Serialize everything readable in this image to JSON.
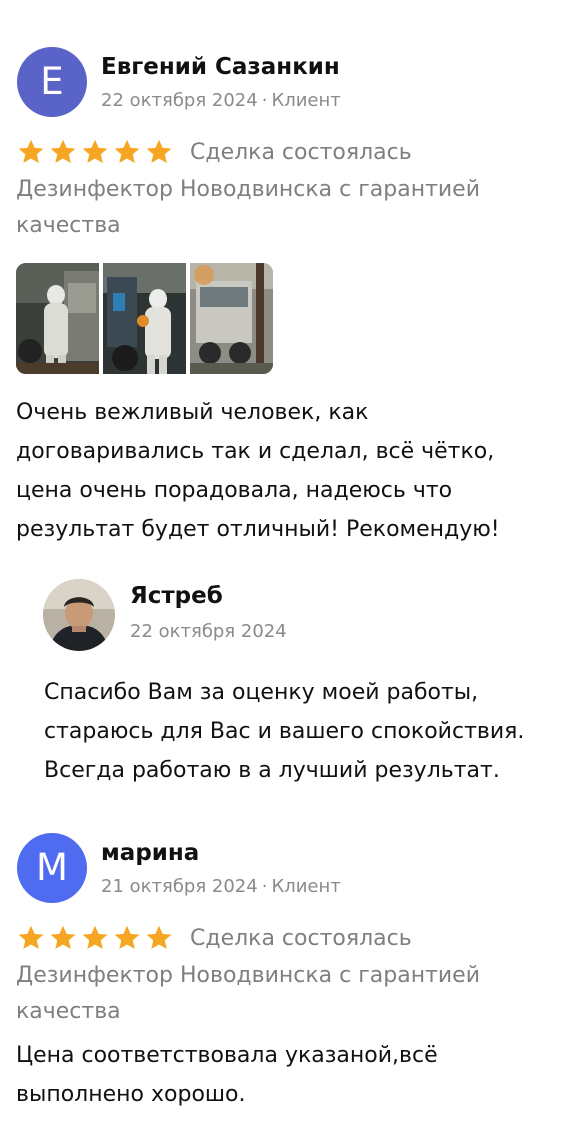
{
  "colors": {
    "star": "#F5A623",
    "avatar_e": "#5A64C8",
    "avatar_m": "#4F6CF0",
    "meta_gray": "#8A8A8A"
  },
  "reviews": [
    {
      "avatar_letter": "Е",
      "author": "Евгений Сазанкин",
      "date": "22 октября 2024",
      "role": "Клиент",
      "rating": 5,
      "deal_status": "Сделка состоялась",
      "service_lines": [
        "Дезинфектор Новодвинска с гарантией",
        "качества"
      ],
      "photos": [
        "photo-1",
        "photo-2",
        "photo-3"
      ],
      "text_lines": [
        "Очень вежливый человек, как",
        "договаривались так и сделал, всё чётко,",
        "цена очень порадовала, надеюсь что",
        "результат будет отличный! Рекомендую!"
      ],
      "reply": {
        "author": "Ястреб",
        "date": "22 октября 2024",
        "text_lines": [
          "Спасибо Вам за оценку моей работы,",
          "стараюсь для Вас и вашего спокойствия.",
          "Всегда работаю в а лучший результат."
        ]
      }
    },
    {
      "avatar_letter": "М",
      "author": "марина",
      "date": "21 октября 2024",
      "role": "Клиент",
      "rating": 5,
      "deal_status": "Сделка состоялась",
      "service_lines": [
        "Дезинфектор Новодвинска с гарантией",
        "качества"
      ],
      "text_lines": [
        "Цена соответствовала указаной,всё",
        "выполнено хорошо."
      ]
    }
  ]
}
